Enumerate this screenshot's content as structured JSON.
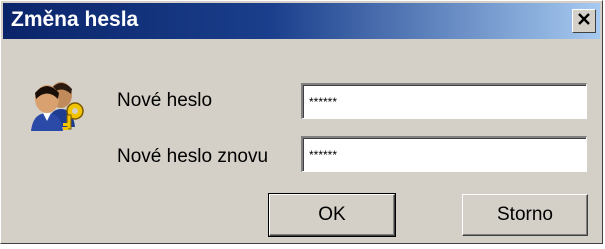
{
  "dialog": {
    "title": "Změna hesla",
    "close_glyph": "×"
  },
  "icon": "users-key-icon",
  "fields": {
    "new_password": {
      "label": "Nové heslo",
      "value": "******"
    },
    "new_password_again": {
      "label": "Nové heslo znovu",
      "value": "******"
    }
  },
  "buttons": {
    "ok_label": "OK",
    "cancel_label": "Storno"
  },
  "colors": {
    "titlebar_start": "#0a246a",
    "titlebar_end": "#a6caf0",
    "face": "#d4d0c8"
  }
}
